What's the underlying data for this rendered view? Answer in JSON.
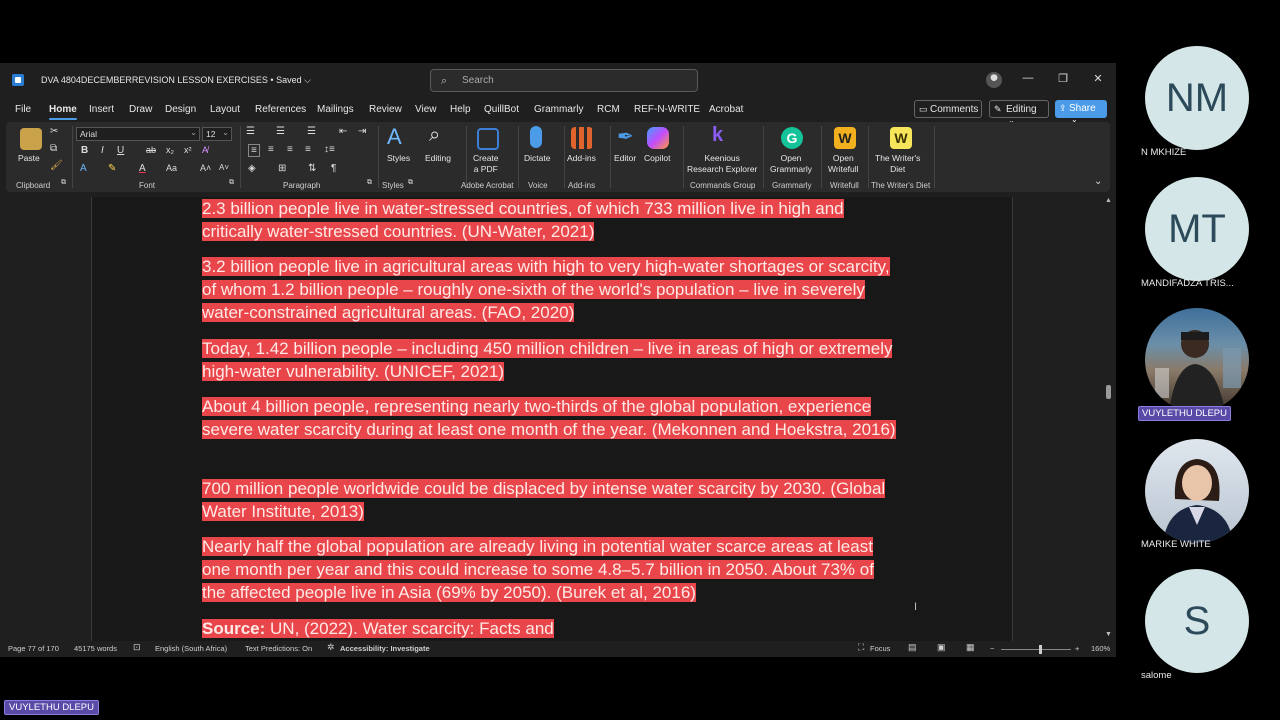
{
  "window": {
    "doc_title": "DVA 4804DECEMBERREVISION LESSON EXERCISES • Saved ⌵",
    "search_placeholder": "Search",
    "minimize": "—",
    "restore": "❐",
    "close": "✕"
  },
  "tabs": [
    "File",
    "Home",
    "Insert",
    "Draw",
    "Design",
    "Layout",
    "References",
    "Mailings",
    "Review",
    "View",
    "Help",
    "QuillBot",
    "Grammarly",
    "RCM",
    "REF-N-WRITE",
    "Acrobat"
  ],
  "active_tab": "Home",
  "header_buttons": {
    "comments": "Comments",
    "editing": "Editing",
    "share": "Share"
  },
  "ribbon": {
    "clipboard": {
      "paste": "Paste",
      "label": "Clipboard"
    },
    "font": {
      "name": "Arial",
      "size": "12",
      "label": "Font"
    },
    "paragraph": {
      "label": "Paragraph"
    },
    "styles": {
      "button": "Styles",
      "label": "Styles"
    },
    "editing": {
      "button": "Editing"
    },
    "acrobat": {
      "button_line1": "Create",
      "button_line2": "a PDF",
      "label": "Adobe Acrobat"
    },
    "voice": {
      "button": "Dictate",
      "label": "Voice"
    },
    "addins": {
      "button": "Add-ins",
      "label": "Add-ins"
    },
    "editor": {
      "button": "Editor"
    },
    "copilot": {
      "button": "Copilot"
    },
    "commands": {
      "button_line1": "Keenious",
      "button_line2": "Research Explorer",
      "label": "Commands Group"
    },
    "grammarly": {
      "button_line1": "Open",
      "button_line2": "Grammarly",
      "label": "Grammarly"
    },
    "writefull": {
      "button_line1": "Open",
      "button_line2": "Writefull",
      "label": "Writefull"
    },
    "writersdiet": {
      "button_line1": "The Writer's",
      "button_line2": "Diet",
      "label": "The Writer's Diet"
    }
  },
  "document": {
    "paragraphs": [
      "2.3 billion people live in water-stressed countries, of which 733 million live in high and critically water-stressed countries. (UN-Water, 2021)",
      "3.2 billion people live in agricultural areas with high to very high-water shortages or scarcity, of whom 1.2 billion people – roughly one-sixth of the world's population – live in severely water-constrained agricultural areas. (FAO, 2020)",
      "Today, 1.42 billion people – including 450 million children – live in areas of high or extremely high-water vulnerability. (UNICEF, 2021)",
      "About 4 billion people, representing nearly two-thirds of the global population, experience severe water scarcity during at least one month of the year. (Mekonnen and Hoekstra, 2016)",
      "700 million people worldwide could be displaced by intense water scarcity by 2030. (Global Water Institute, 2013)",
      "Nearly half the global population are already living in potential water scarce areas at least one month per year and this could increase to some 4.8–5.7 billion in 2050. About 73% of the affected people live in Asia (69% by 2050). (Burek et al, 2016)"
    ],
    "source_label": "Source:",
    "source_text": " UN, (2022). Water scarcity: Facts and"
  },
  "status": {
    "page": "Page 77 of 170",
    "words": "45175 words",
    "language": "English (South Africa)",
    "predictions": "Text Predictions: On",
    "accessibility": "Accessibility: Investigate",
    "focus": "Focus",
    "zoom": "160%"
  },
  "participants": [
    {
      "initials": "NM",
      "name": "N MKHIZE"
    },
    {
      "initials": "MT",
      "name": "MANDIFADZA TRIS..."
    },
    {
      "initials": "",
      "name": "VUYLETHU DLEPU"
    },
    {
      "initials": "",
      "name": "MARIKE WHITE"
    },
    {
      "initials": "S",
      "name": "salome"
    }
  ],
  "active_speaker": "VUYLETHU DLEPU",
  "colors": {
    "highlight": "#e8464a",
    "accent": "#4c9be8",
    "speaker": "#5a4aa8"
  }
}
